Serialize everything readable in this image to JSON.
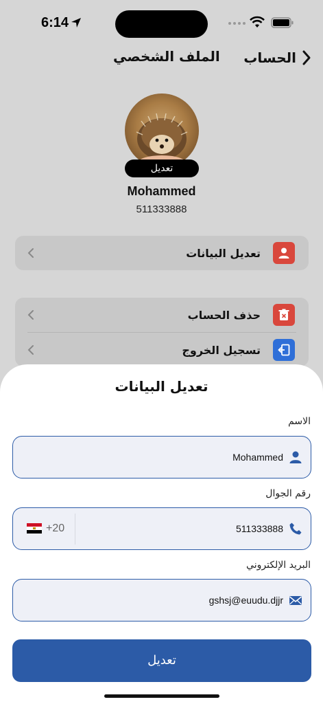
{
  "status_bar": {
    "time": "6:14"
  },
  "header": {
    "back_label": "الحساب",
    "title": "الملف الشخصي"
  },
  "profile": {
    "edit_badge": "تعديل",
    "name": "Mohammed",
    "phone": "511333888"
  },
  "menu": {
    "edit_data": "تعديل البيانات",
    "delete_account": "حذف الحساب",
    "logout": "تسجيل الخروج"
  },
  "sheet": {
    "title": "تعديل البيانات",
    "name_label": "الاسم",
    "name_value": "Mohammed",
    "phone_label": "رقم الجوال",
    "phone_value": "511333888",
    "country_code": "+20",
    "email_label": "البريد الإلكتروني",
    "email_value": "gshsj@euudu.djjr",
    "submit_label": "تعديل"
  },
  "colors": {
    "accent": "#2c5ba7",
    "danger": "#d9473c",
    "logout": "#2f6fd8"
  }
}
